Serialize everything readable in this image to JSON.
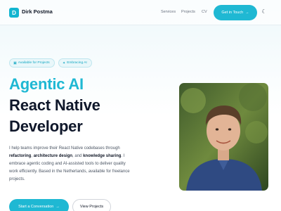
{
  "header": {
    "logo_letter": "D",
    "brand": "Dirk Postma",
    "nav": [
      "Services",
      "Projects",
      "CV"
    ],
    "cta": "Get in Touch",
    "cta_icon": "arrow-right-icon",
    "theme_icon": "moon-icon"
  },
  "hero": {
    "badges": [
      {
        "label": "Available for Projects",
        "icon": "briefcase-icon"
      },
      {
        "label": "Embracing AI",
        "icon": "sparkles-icon"
      }
    ],
    "title_accent": "Agentic AI",
    "title_line2": "React Native",
    "title_line3": "Developer",
    "para": {
      "p1": "I help teams improve their React Native codebases through ",
      "b1": "refactoring",
      "p2": ", ",
      "b2": "architecture design",
      "p3": ", and ",
      "b3": "knowledge sharing",
      "p4": ". I embrace agentic coding and AI-assisted tools to deliver quality work efficiently. Based in the Netherlands, available for freelance projects."
    },
    "primary_button": "Start a Conversation",
    "secondary_button": "View Projects"
  },
  "colors": {
    "accent": "#1fb8d3",
    "text": "#0f172a"
  }
}
